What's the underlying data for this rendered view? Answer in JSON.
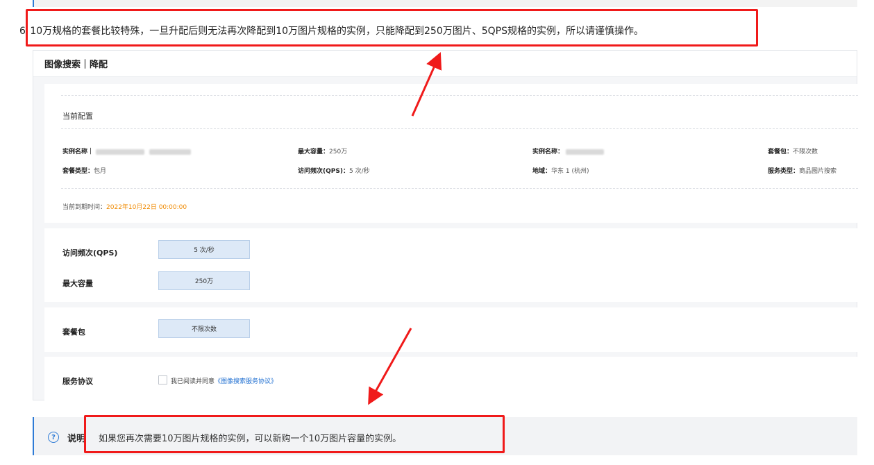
{
  "step": {
    "number": "6",
    "text": "10万规格的套餐比较特殊，一旦升配后则无法再次降配到10万图片规格的实例，只能降配到250万图片、5QPS规格的实例，所以请谨慎操作。"
  },
  "panel": {
    "title": "图像搜索｜降配",
    "current_config": {
      "title": "当前配置",
      "instance_name_label": "实例名称",
      "max_capacity_label": "最大容量",
      "max_capacity_value": "250万",
      "instance_id_label": "实例名称",
      "package_label": "套餐包",
      "package_value": "不限次数",
      "plan_type_label": "套餐类型",
      "plan_type_value": "包月",
      "qps_label": "访问频次(QPS)",
      "qps_value": "5 次/秒",
      "region_label": "地域",
      "region_value": "华东 1 (杭州)",
      "service_type_label": "服务类型",
      "service_type_value": "商品图片搜索",
      "expire_label": "当前到期时间",
      "expire_value": "2022年10月22日 00:00:00"
    },
    "form": {
      "qps_label": "访问频次(QPS)",
      "qps_value": "5 次/秒",
      "capacity_label": "最大容量",
      "capacity_value": "250万",
      "package_label": "套餐包",
      "package_value": "不限次数",
      "agreement_label": "服务协议",
      "agreement_text": "我已阅读并同意",
      "agreement_link": "《图像搜索服务协议》"
    }
  },
  "note": {
    "icon": "question-circle-icon",
    "title": "说明",
    "text": "如果您再次需要10万图片规格的实例，可以新购一个10万图片容量的实例。"
  },
  "colors": {
    "highlight": "#f01a1a",
    "accent": "#2e7bd6",
    "expire": "#f08a00",
    "link": "#1f6fd1"
  }
}
